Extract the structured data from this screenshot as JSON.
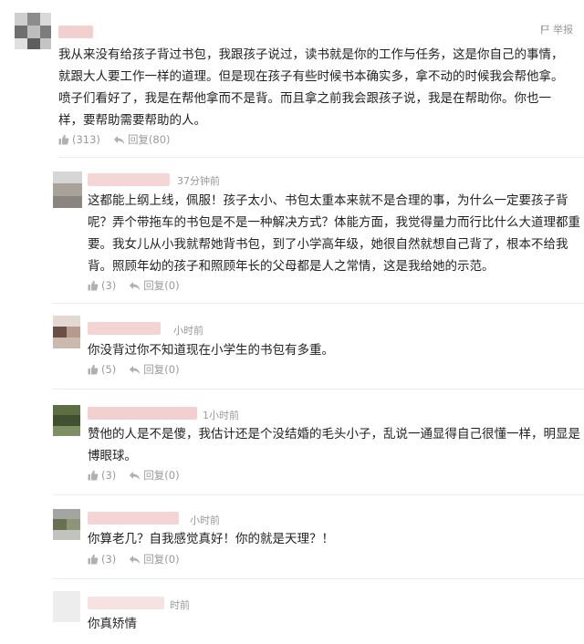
{
  "report_label": "举报",
  "main_comment": {
    "text": "我从来没有给孩子背过书包，我跟孩子说过，读书就是你的工作与任务，这是你自己的事情，就跟大人要工作一样的道理。但是现在孩子有些时候书本确实多，拿不动的时候我会帮他拿。喷子们看好了，我是在帮他拿而不是背。而且拿之前我会跟孩子说，我是在帮助你。你也一样，要帮助需要帮助的人。",
    "likes": "(313)",
    "reply_label": "回复(80)"
  },
  "replies": [
    {
      "time": "37分钟前",
      "text": "这都能上纲上线，佩服！孩子太小、书包太重本来就不是合理的事，为什么一定要孩子背呢？弄个带拖车的书包是不是一种解决方式？体能方面，我觉得量力而行比什么大道理都重要。我女儿从小我就帮她背书包，到了小学高年级，她很自然就想自己背了，根本不给我背。照顾年幼的孩子和照顾年长的父母都是人之常情，这是我给她的示范。",
      "likes": "(3)",
      "reply_label": "回复(0)"
    },
    {
      "time": "小时前",
      "text": "你没背过你不知道现在小学生的书包有多重。",
      "likes": "(5)",
      "reply_label": "回复(0)"
    },
    {
      "time": "1小时前",
      "text": "赞他的人是不是傻，我估计还是个没结婚的毛头小子，乱说一通显得自己很懂一样，明显是博眼球。",
      "likes": "(3)",
      "reply_label": "回复(0)"
    },
    {
      "time": "小时前",
      "text": "你算老几？自我感觉真好！你的就是天理？！",
      "likes": "(3)",
      "reply_label": "回复(0)"
    },
    {
      "time": "时前",
      "text": "你真矫情"
    }
  ],
  "colors": {
    "text": "#222222",
    "meta": "#999999",
    "divider": "#ececec"
  }
}
